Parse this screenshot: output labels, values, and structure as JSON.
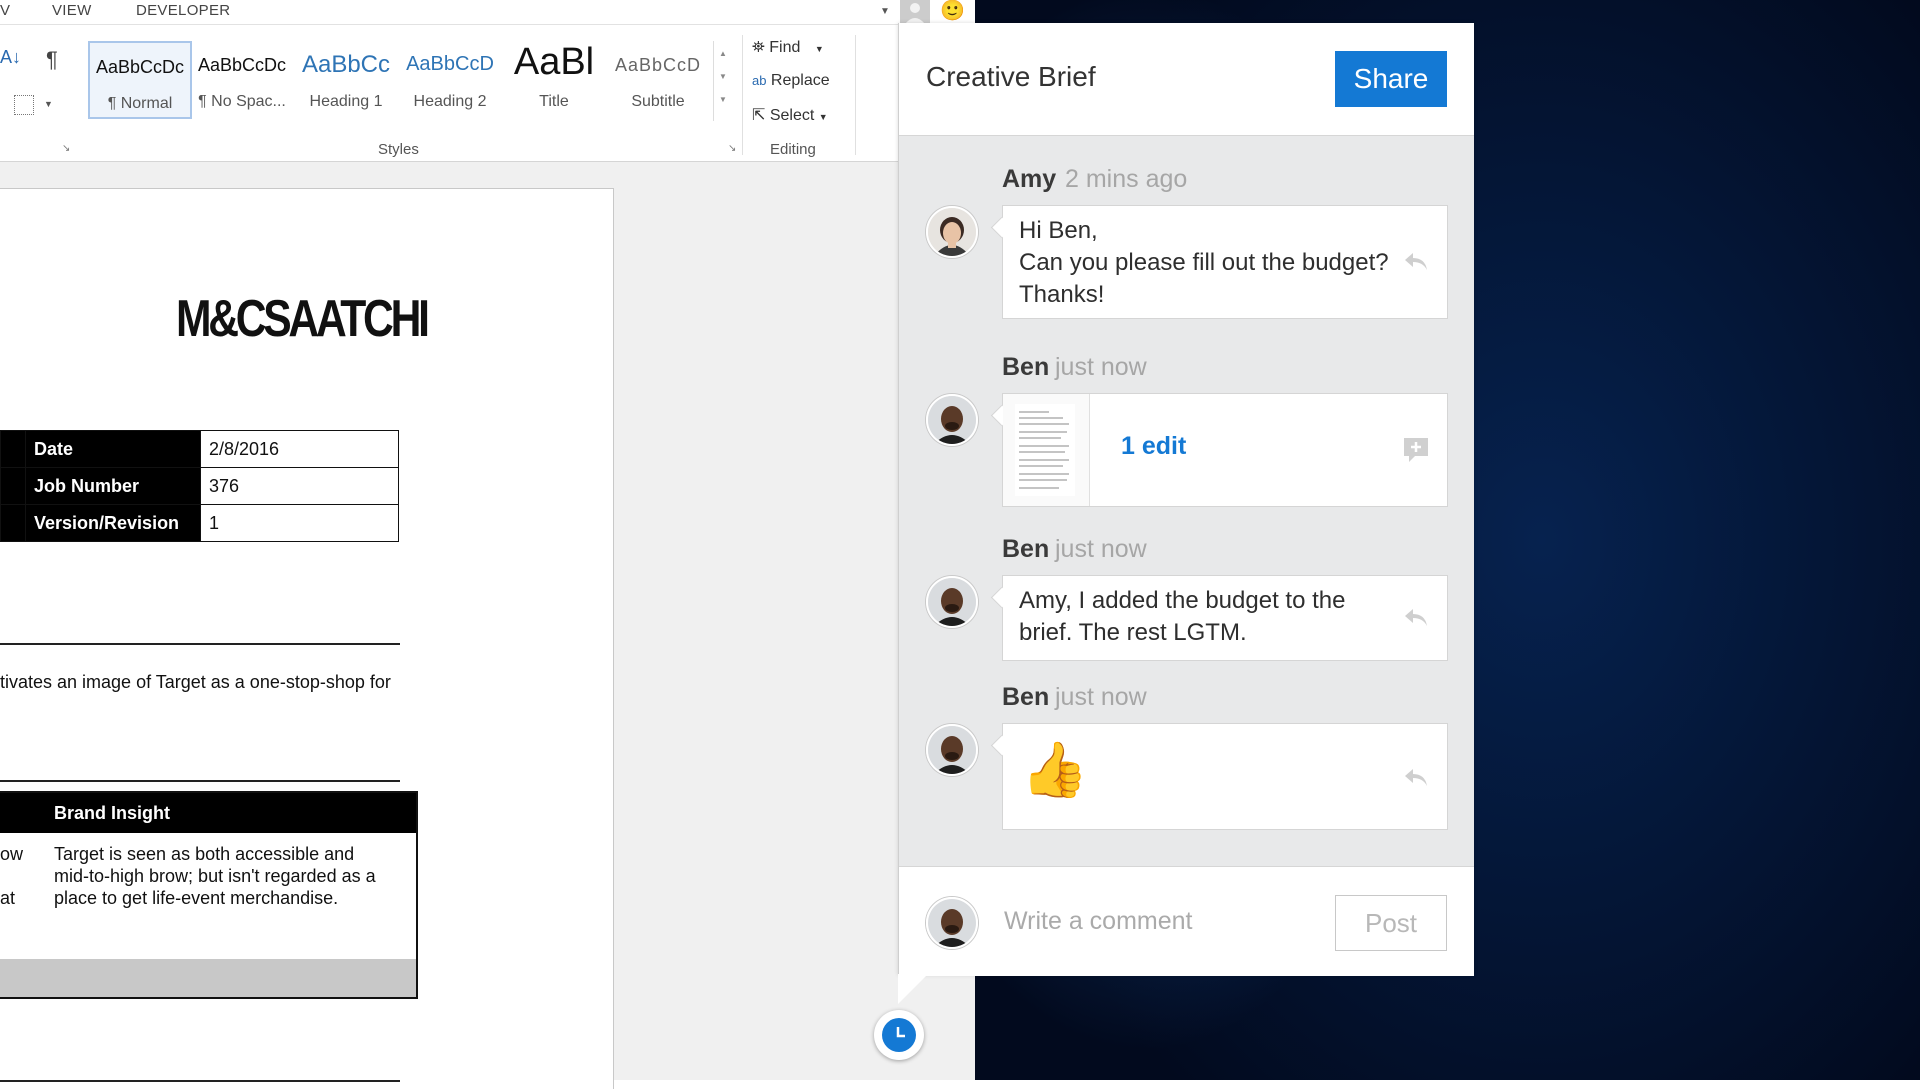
{
  "menu": {
    "items": [
      "V",
      "VIEW",
      "DEVELOPER"
    ]
  },
  "ribbon": {
    "styles": [
      {
        "sample": "AaBbCcDc",
        "name": "¶ Normal"
      },
      {
        "sample": "AaBbCcDc",
        "name": "¶ No Spac..."
      },
      {
        "sample": "AaBbCc",
        "name": "Heading 1"
      },
      {
        "sample": "AaBbCcD",
        "name": "Heading 2"
      },
      {
        "sample": "AaBl",
        "name": "Title"
      },
      {
        "sample": "AaBbCcD",
        "name": "Subtitle"
      }
    ],
    "styles_group_label": "Styles",
    "editing": {
      "find": "Find",
      "replace": "Replace",
      "select": "Select",
      "group_label": "Editing"
    }
  },
  "document": {
    "logo": "M&CSAATCHI",
    "info_table": [
      {
        "label": "Date",
        "value": "2/8/2016"
      },
      {
        "label": "Job Number",
        "value": "376"
      },
      {
        "label": "Version/Revision",
        "value": "1"
      }
    ],
    "line1": "tivates an image of Target as a one-stop-shop for",
    "insight_header": "Brand Insight",
    "insight_left": [
      "ow",
      "at"
    ],
    "insight_text": [
      "Target is seen as both accessible and",
      "mid-to-high brow; but isn't regarded as a",
      "place to get life-event merchandise."
    ]
  },
  "panel": {
    "title": "Creative Brief",
    "share_label": "Share",
    "comments": [
      {
        "author": "Amy",
        "time": "2 mins ago",
        "lines": [
          "Hi Ben,",
          "Can you please fill out the budget?",
          "Thanks!"
        ]
      },
      {
        "author": "Ben",
        "time": "just now",
        "edit_label": "1 edit"
      },
      {
        "author": "Ben",
        "time": "just now",
        "lines": [
          "Amy, I added the budget to the",
          "brief. The rest LGTM."
        ]
      },
      {
        "author": "Ben",
        "time": "just now",
        "emoji": "👍"
      }
    ],
    "composer": {
      "placeholder": "Write a comment",
      "post_label": "Post"
    }
  },
  "colors": {
    "accent": "#1479d4",
    "panel_bg": "#e8e9ea"
  }
}
